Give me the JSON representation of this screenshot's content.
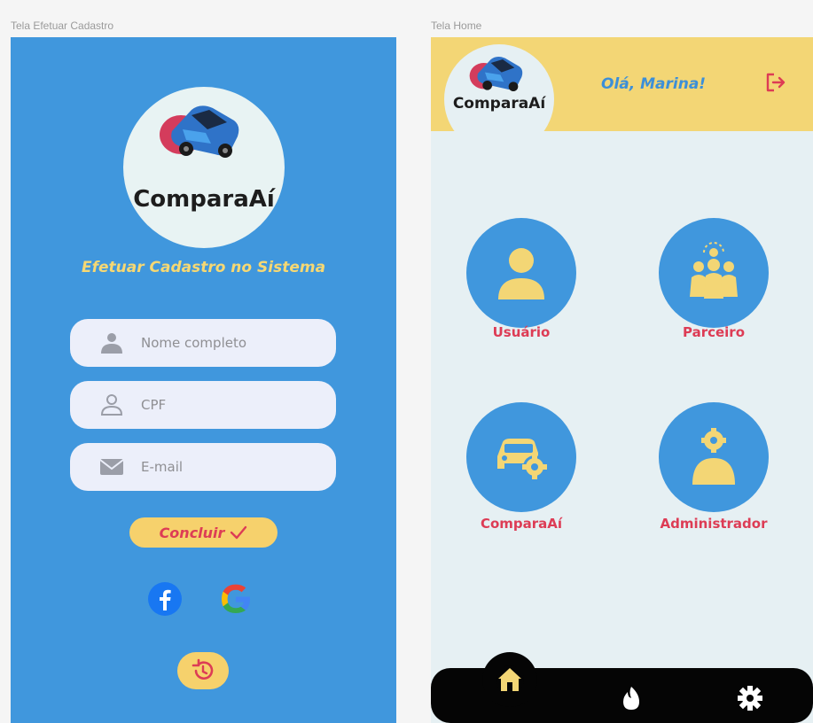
{
  "frames": {
    "left_label": "Tela Efetuar Cadastro",
    "right_label": "Tela Home"
  },
  "signup": {
    "logo_text": "ComparaAí",
    "headline": "Efetuar Cadastro no Sistema",
    "fields": [
      {
        "placeholder": "Nome completo",
        "value": "",
        "icon": "user-icon"
      },
      {
        "placeholder": "CPF",
        "value": "",
        "icon": "person-outline-icon"
      },
      {
        "placeholder": "E-mail",
        "value": "",
        "icon": "mail-icon"
      }
    ],
    "submit_label": "Concluir",
    "social": [
      "facebook-icon",
      "google-icon"
    ],
    "history_icon": "history-icon"
  },
  "home": {
    "logo_text": "ComparaAí",
    "greeting": "Olá, Marina!",
    "tiles": [
      {
        "label": "Usuário",
        "icon": "user-icon"
      },
      {
        "label": "Parceiro",
        "icon": "team-icon"
      },
      {
        "label": "ComparaAí",
        "icon": "car-settings-icon"
      },
      {
        "label": "Administrador",
        "icon": "admin-icon"
      }
    ],
    "nav": [
      "home-icon",
      "fire-icon",
      "gear-icon"
    ]
  },
  "colors": {
    "blue": "#4097dd",
    "yellow": "#f6d16c",
    "pink": "#dd3c55",
    "light": "#e6f0f3"
  }
}
